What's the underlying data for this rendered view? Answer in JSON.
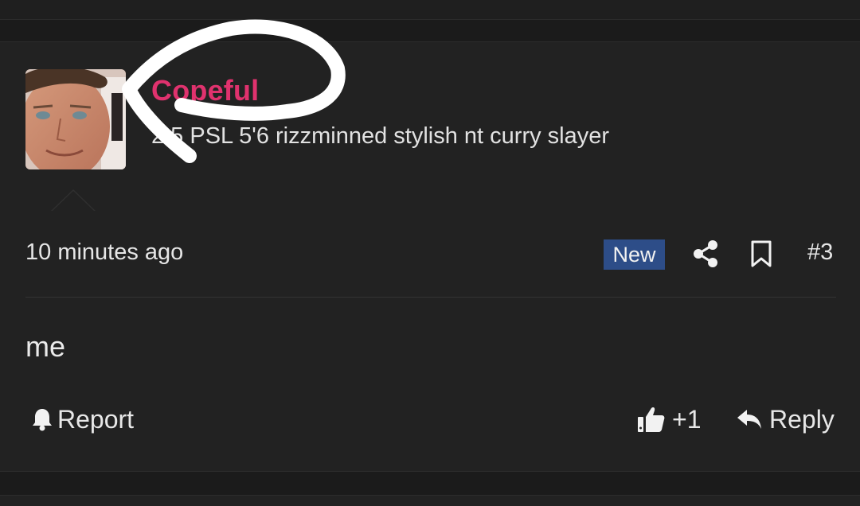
{
  "post": {
    "user": {
      "name": "Copeful",
      "title": "2.5 PSL 5'6 rizzminned stylish nt curry slayer"
    },
    "timestamp": "10 minutes ago",
    "badge": "New",
    "post_number": "#3",
    "message": "me",
    "actions": {
      "report_label": "Report",
      "like_count": "+1",
      "reply_label": "Reply"
    }
  },
  "icons": {
    "share": "share-icon",
    "bookmark": "bookmark-icon",
    "bell": "bell-icon",
    "thumbs_up": "thumbs-up-icon",
    "reply": "reply-arrow-icon"
  },
  "colors": {
    "background": "#222222",
    "username": "#e0326e",
    "badge": "#2d4d88",
    "text": "#e6e6e6",
    "annotation_stroke": "#ffffff"
  }
}
